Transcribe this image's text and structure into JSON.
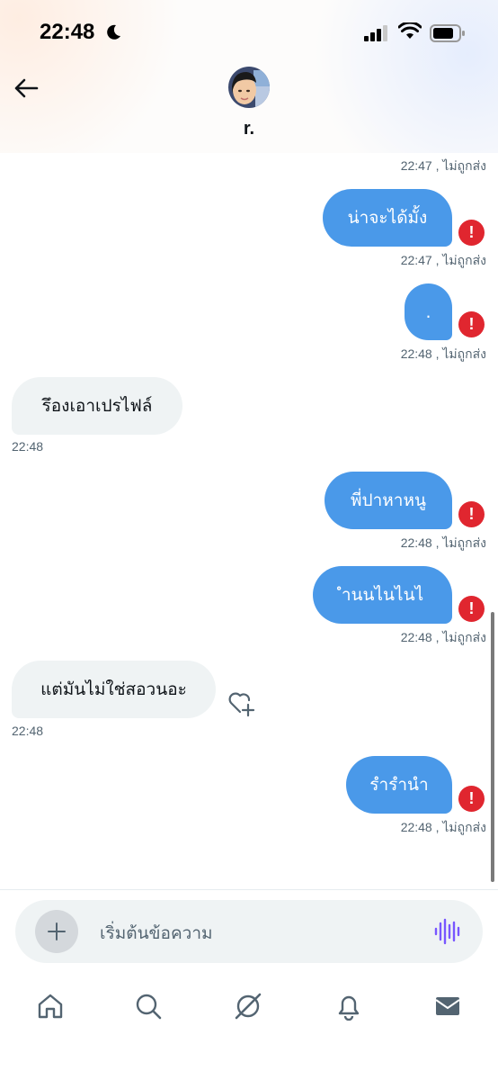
{
  "status_bar": {
    "time": "22:48"
  },
  "header": {
    "contact_name": "r."
  },
  "messages": [
    {
      "type": "meta",
      "align": "right",
      "text": "22:47 , ไม่ถูกส่ง"
    },
    {
      "type": "sent",
      "text": "น่าจะได้มั้ง",
      "meta": "22:47 , ไม่ถูกส่ง",
      "error": "!"
    },
    {
      "type": "sent",
      "text": ".",
      "meta": "22:48 , ไม่ถูกส่ง",
      "error": "!"
    },
    {
      "type": "recv",
      "text": "รึองเอาเปรไฟล์",
      "meta": "22:48"
    },
    {
      "type": "sent",
      "text": "พี่ปาหาหนู",
      "meta": "22:48 , ไม่ถูกส่ง",
      "error": "!"
    },
    {
      "type": "sent",
      "text": "ำนนไนไนไ",
      "meta": "22:48 , ไม่ถูกส่ง",
      "error": "!"
    },
    {
      "type": "recv",
      "text": "แต่มันไม่ใช่สอวนอะ",
      "meta": "22:48"
    },
    {
      "type": "sent",
      "text": "รำรำนำ",
      "meta": "22:48 , ไม่ถูกส่ง",
      "error": "!"
    }
  ],
  "composer": {
    "placeholder": "เริ่มต้นข้อความ"
  },
  "icons": {
    "status": [
      "moon-icon",
      "signal-icon",
      "wifi-icon",
      "battery-icon"
    ],
    "header": [
      "back-arrow-icon"
    ],
    "composer": [
      "plus-icon",
      "voice-message-icon"
    ],
    "nav": [
      "home-icon",
      "search-icon",
      "grok-icon",
      "notifications-bell-icon",
      "messages-envelope-icon"
    ]
  },
  "colors": {
    "sent_bubble": "#4a99e9",
    "received_bubble": "#eff3f4",
    "error": "#e0262f",
    "voice_accent": "#7856ff",
    "meta_text": "#536471"
  }
}
